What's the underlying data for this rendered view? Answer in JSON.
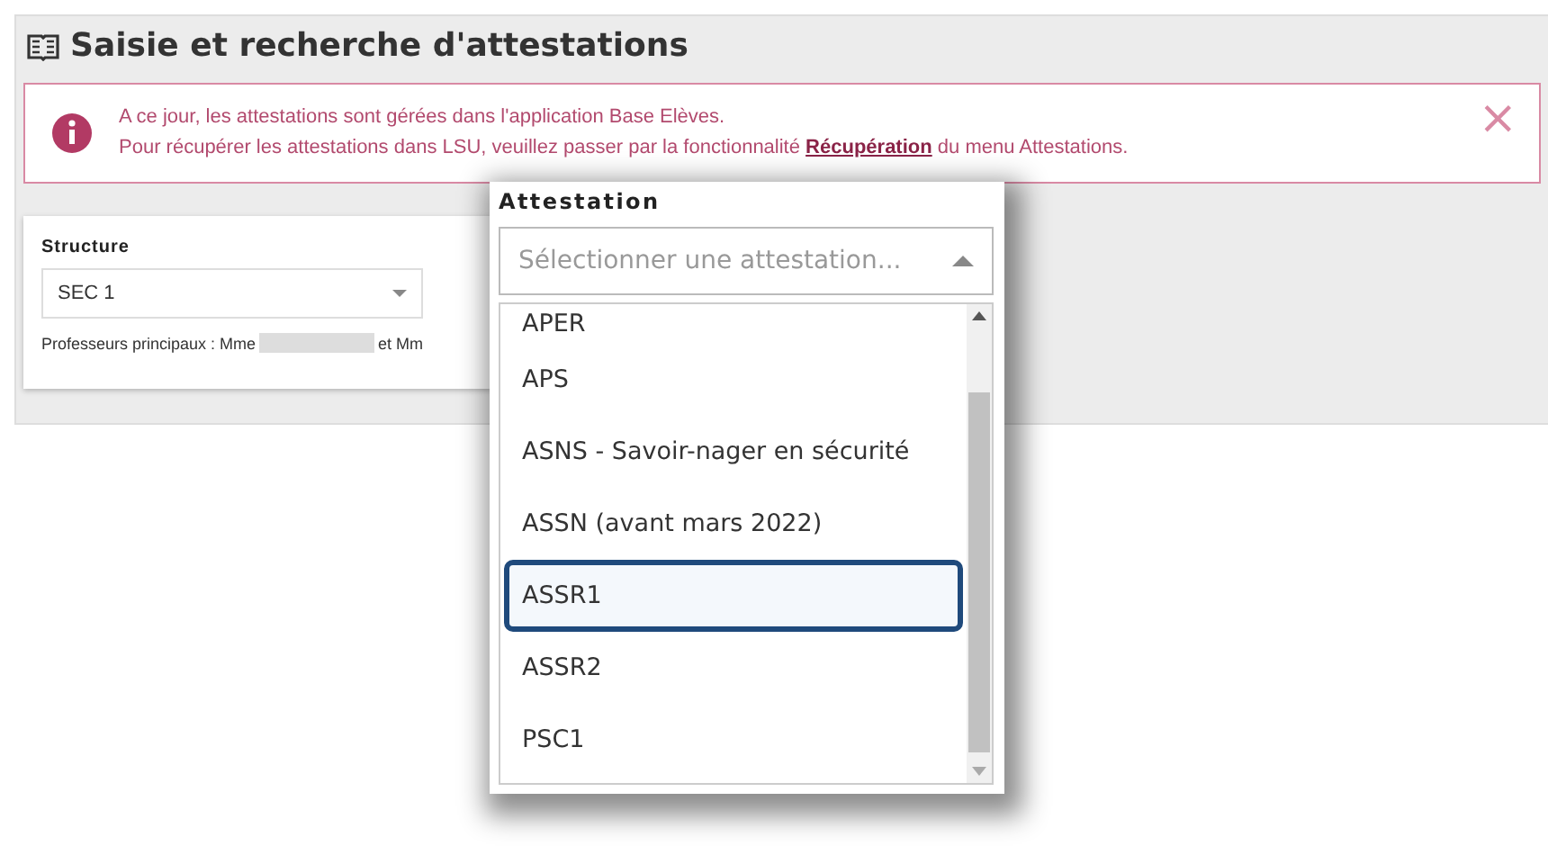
{
  "page": {
    "title": "Saisie et recherche d'attestations"
  },
  "banner": {
    "lines": [
      "A ce jour, les attestations sont gérées dans l'application Base Elèves.",
      "Pour récupérer les attestations dans LSU, veuillez passer par la fonctionnalité **Récupération** du menu Attestations."
    ],
    "close": "×"
  },
  "structure": {
    "label": "Structure",
    "value": "SEC 1",
    "teachers_prefix": "Professeurs principaux : Mme",
    "teachers_middle": "et Mm"
  },
  "attestation": {
    "label": "Attestation",
    "placeholder": "Sélectionner une attestation...",
    "options": [
      {
        "label": "APER",
        "selected": false
      },
      {
        "label": "APS",
        "selected": false
      },
      {
        "label": "ASNS - Savoir-nager en sécurité",
        "selected": false
      },
      {
        "label": "ASSN (avant mars 2022)",
        "selected": false
      },
      {
        "label": "ASSR1",
        "selected": true
      },
      {
        "label": "ASSR2",
        "selected": false
      },
      {
        "label": "PSC1",
        "selected": false
      }
    ]
  }
}
